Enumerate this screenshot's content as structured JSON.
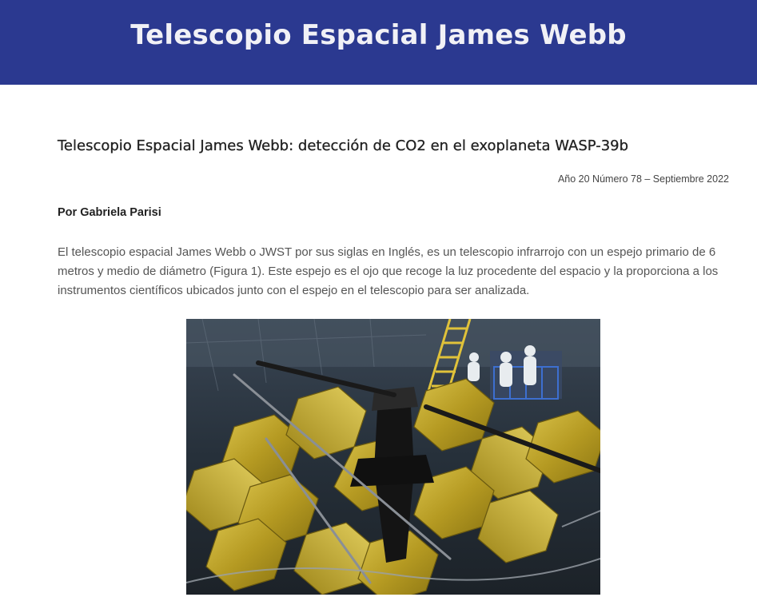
{
  "header": {
    "site_title": "Telescopio Espacial James Webb",
    "background_color": "#2b3990"
  },
  "article": {
    "title": "Telescopio Espacial James Webb: detección de CO2 en el exoplaneta WASP-39b",
    "issue_info": "Año 20 Número 78 – Septiembre 2022",
    "author": "Por Gabriela Parisi",
    "paragraph": "El telescopio espacial James Webb o JWST por sus siglas en Inglés, es un telescopio infrarrojo con un espejo primario de 6 metros y medio de diámetro (Figura 1). Este espejo es el ojo que recoge la luz procedente del espacio y la proporciona a los instrumentos científicos ubicados junto con el espejo en el telescopio para ser analizada.",
    "figure": {
      "subject": "photo-jwst-primary-mirror"
    }
  }
}
